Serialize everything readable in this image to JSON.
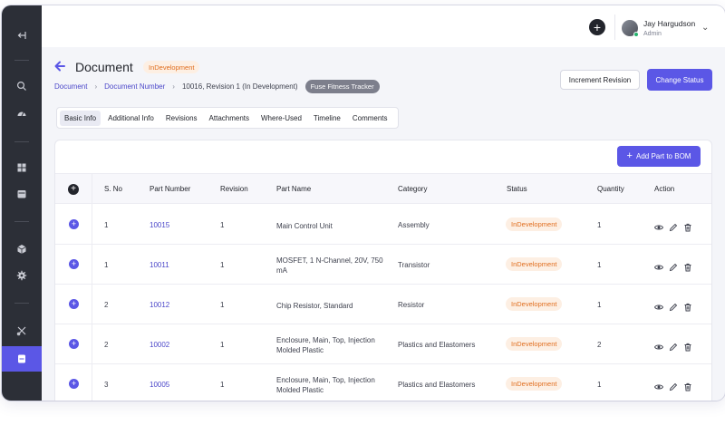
{
  "user": {
    "name": "Jay Hargudson",
    "role": "Admin"
  },
  "page": {
    "title": "Document",
    "status": "InDevelopment",
    "breadcrumbs": [
      "Document",
      "Document Number",
      "10016, Revision 1 (In Development)"
    ],
    "tag": "Fuse Fitness Tracker"
  },
  "actions": {
    "increment_revision": "Increment Revision",
    "change_status": "Change Status"
  },
  "tabs": [
    "Basic Info",
    "Additional Info",
    "Revisions",
    "Attachments",
    "Where-Used",
    "Timeline",
    "Comments"
  ],
  "bom": {
    "add_button": "Add Part to BOM",
    "columns": [
      "S. No",
      "Part Number",
      "Revision",
      "Part Name",
      "Category",
      "Status",
      "Quantity",
      "Action"
    ],
    "rows": [
      {
        "sno": "1",
        "part_number": "10015",
        "revision": "1",
        "part_name": "Main Control Unit",
        "category": "Assembly",
        "status": "InDevelopment",
        "quantity": "1"
      },
      {
        "sno": "1",
        "part_number": "10011",
        "revision": "1",
        "part_name": "MOSFET, 1 N-Channel, 20V, 750 mA",
        "category": "Transistor",
        "status": "InDevelopment",
        "quantity": "1"
      },
      {
        "sno": "2",
        "part_number": "10012",
        "revision": "1",
        "part_name": "Chip Resistor, Standard",
        "category": "Resistor",
        "status": "InDevelopment",
        "quantity": "1"
      },
      {
        "sno": "2",
        "part_number": "10002",
        "revision": "1",
        "part_name": "Enclosure, Main, Top, Injection Molded Plastic",
        "category": "Plastics and Elastomers",
        "status": "InDevelopment",
        "quantity": "2"
      },
      {
        "sno": "3",
        "part_number": "10005",
        "revision": "1",
        "part_name": "Enclosure, Main, Top, Injection Molded Plastic",
        "category": "Plastics and Elastomers",
        "status": "InDevelopment",
        "quantity": "1"
      }
    ]
  },
  "colors": {
    "accent": "#5b57e6",
    "sidebar": "#2c2f37",
    "status_text": "#e06e1f",
    "status_bg": "#fdefe3"
  }
}
